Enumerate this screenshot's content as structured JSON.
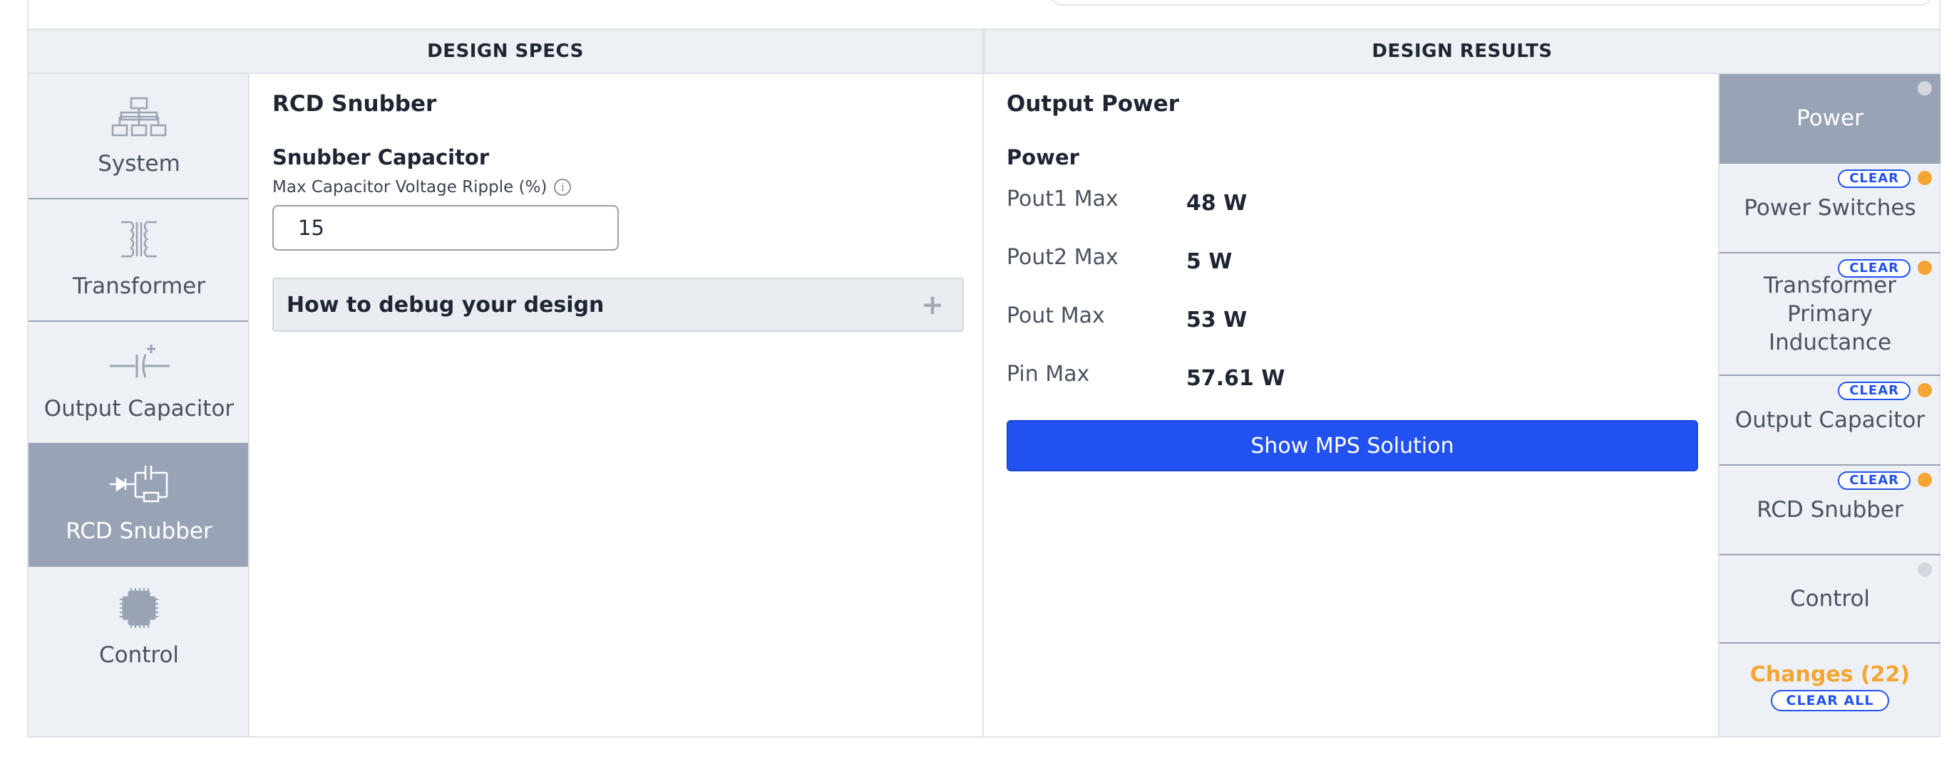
{
  "headers": {
    "specs": "DESIGN SPECS",
    "results": "DESIGN RESULTS"
  },
  "left_nav": {
    "items": [
      {
        "label": "System",
        "icon": "system-hierarchy-icon",
        "active": false
      },
      {
        "label": "Transformer",
        "icon": "transformer-icon",
        "active": false
      },
      {
        "label": "Output Capacitor",
        "icon": "capacitor-icon",
        "active": false
      },
      {
        "label": "RCD Snubber",
        "icon": "rcd-snubber-icon",
        "active": true
      },
      {
        "label": "Control",
        "icon": "chip-icon",
        "active": false
      }
    ]
  },
  "specs": {
    "title": "RCD Snubber",
    "field_title": "Snubber Capacitor",
    "field_sub": "Max Capacitor Voltage Ripple (%)",
    "field_value": "15",
    "debug_label": "How to debug your design"
  },
  "results": {
    "title": "Output Power",
    "sub": "Power",
    "rows": [
      {
        "label": "Pout1 Max",
        "value": "48 W"
      },
      {
        "label": "Pout2 Max",
        "value": "5 W"
      },
      {
        "label": "Pout Max",
        "value": "53 W"
      },
      {
        "label": "Pin Max",
        "value": "57.61 W"
      }
    ],
    "button_label": "Show MPS Solution"
  },
  "right_nav": {
    "items": [
      {
        "label": "Power",
        "clear": "",
        "dot": "gray"
      },
      {
        "label": "Power Switches",
        "clear": "CLEAR",
        "dot": "orange"
      },
      {
        "label": "Transformer Primary Inductance",
        "clear": "CLEAR",
        "dot": "orange"
      },
      {
        "label": "Output Capacitor",
        "clear": "CLEAR",
        "dot": "orange"
      },
      {
        "label": "RCD Snubber",
        "clear": "CLEAR",
        "dot": "orange"
      },
      {
        "label": "Control",
        "clear": "",
        "dot": "gray"
      }
    ],
    "changes_label": "Changes (22)",
    "clear_all_label": "CLEAR ALL"
  },
  "colors": {
    "accent_blue": "#2152f1",
    "warning_orange": "#f4a534",
    "active_nav": "#98a3b5",
    "panel_bg": "#edf0f4"
  }
}
